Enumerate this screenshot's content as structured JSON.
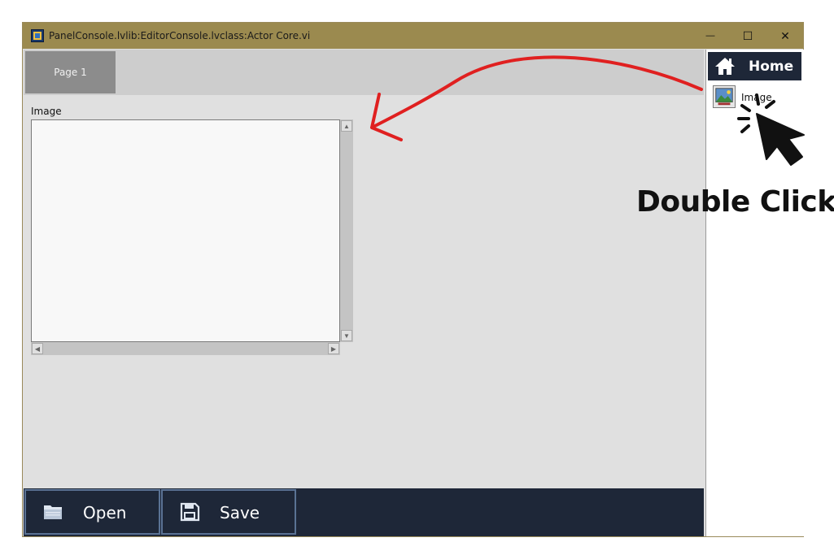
{
  "window": {
    "title": "PanelConsole.lvlib:EditorConsole.lvclass:Actor Core.vi",
    "minimize_glyph": "—",
    "maximize_glyph": "☐",
    "close_glyph": "✕"
  },
  "tabs": [
    {
      "label": "Page 1",
      "selected": true
    }
  ],
  "image_panel": {
    "label": "Image"
  },
  "toolbar": {
    "open_label": "Open",
    "save_label": "Save"
  },
  "sidebar": {
    "home_label": "Home",
    "items": [
      {
        "label": "Image",
        "icon": "image-icon"
      }
    ]
  },
  "annotation": {
    "text": "Double Click",
    "arrow_color": "#e02020"
  },
  "colors": {
    "titlebar": "#9b8a4f",
    "bottombar": "#1e2738",
    "button_border": "#5a7294",
    "tab": "#8c8c8c"
  }
}
